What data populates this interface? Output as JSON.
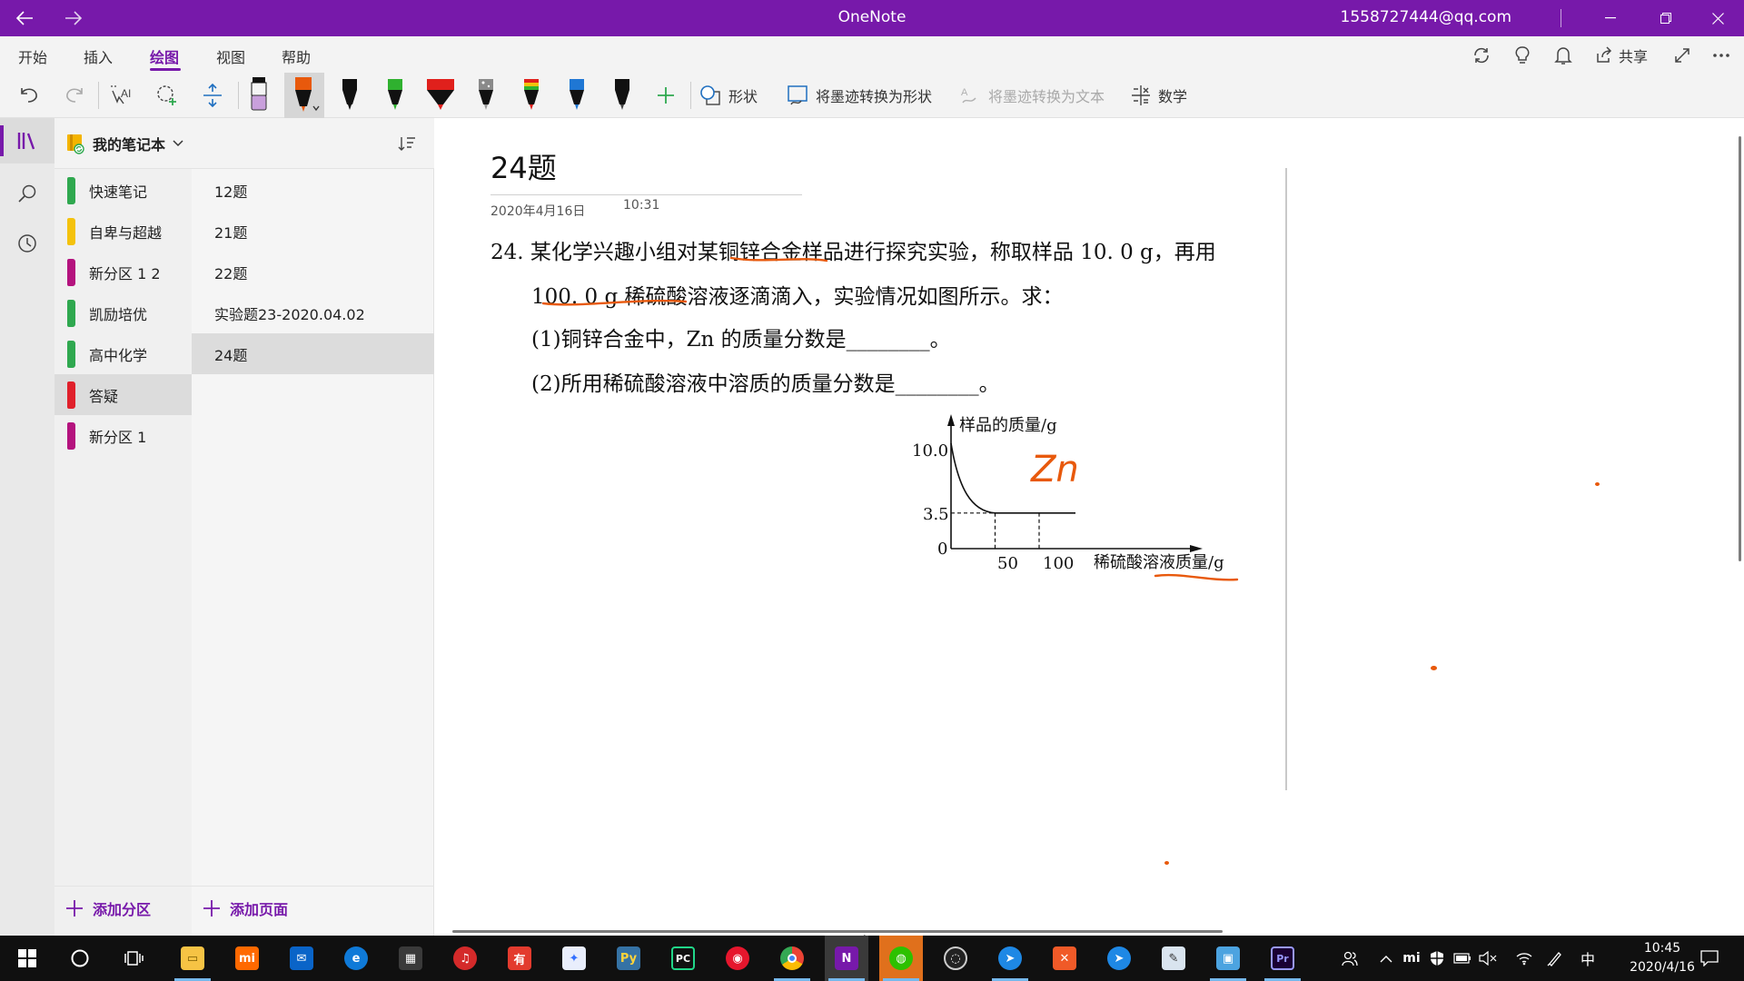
{
  "window": {
    "title": "OneNote",
    "account": "1558727444@qq.com"
  },
  "menu": {
    "items": [
      "开始",
      "插入",
      "绘图",
      "视图",
      "帮助"
    ],
    "active": "绘图",
    "share_label": "共享"
  },
  "toolbar": {
    "shape_label": "形状",
    "ink_to_shape_label": "将墨迹转换为形状",
    "ink_to_text_label": "将墨迹转换为文本",
    "math_label": "数学",
    "pens": [
      {
        "color": "#c9a0dc",
        "kind": "highlighter"
      },
      {
        "color": "#e8590c",
        "kind": "pen",
        "selected": true
      },
      {
        "color": "#111111",
        "kind": "pen"
      },
      {
        "color": "#2fb12f",
        "kind": "pen"
      },
      {
        "color": "#e0201c",
        "kind": "marker"
      },
      {
        "color": "#8a8a8a",
        "kind": "galaxy"
      },
      {
        "color": "#d4a017",
        "kind": "rainbow"
      },
      {
        "color": "#1f77d4",
        "kind": "pen"
      },
      {
        "color": "#111111",
        "kind": "pencil"
      }
    ]
  },
  "notebook": {
    "name": "我的笔记本",
    "sections": [
      {
        "label": "快速笔记",
        "color": "#2fa84f"
      },
      {
        "label": "自卑与超越",
        "color": "#f4c20d"
      },
      {
        "label": "新分区 1 2",
        "color": "#b4137e"
      },
      {
        "label": "凯励培优",
        "color": "#2fa84f"
      },
      {
        "label": "高中化学",
        "color": "#2fa84f"
      },
      {
        "label": "答疑",
        "color": "#e0202b",
        "selected": true
      },
      {
        "label": "新分区 1",
        "color": "#b4137e"
      }
    ],
    "pages": [
      {
        "label": "12题"
      },
      {
        "label": "21题"
      },
      {
        "label": "22题"
      },
      {
        "label": "实验题23-2020.04.02"
      },
      {
        "label": "24题",
        "selected": true
      }
    ],
    "add_section": "添加分区",
    "add_page": "添加页面"
  },
  "page": {
    "title": "24题",
    "date": "2020年4月16日",
    "time": "10:31",
    "question": {
      "line1": "24. 某化学兴趣小组对某铜锌合金样品进行探究实验，称取样品 10. 0 g，再用",
      "line2": "100. 0 g 稀硫酸溶液逐滴滴入，实验情况如图所示。求：",
      "line3": "(1)铜锌合金中，Zn 的质量分数是________。",
      "line4": "(2)所用稀硫酸溶液中溶质的质量分数是________。"
    },
    "figure": {
      "ylabel": "样品的质量/g",
      "xlabel": "稀硫酸溶液质量/g",
      "y_ticks": [
        "10.0",
        "3.5",
        "0"
      ],
      "x_ticks": [
        "50",
        "100"
      ],
      "handwriting": "Zn"
    }
  },
  "chart_data": {
    "type": "line",
    "x": [
      0,
      50,
      100
    ],
    "y": [
      10.0,
      3.5,
      3.5
    ],
    "xlabel": "稀硫酸溶液质量/g",
    "ylabel": "样品的质量/g"
  },
  "colors": {
    "accent": "#7719aa",
    "ink": "#e8590c"
  },
  "taskbar": {
    "apps": [
      "windows-start",
      "search",
      "task-view",
      "file-explorer",
      "mi",
      "mail",
      "edge",
      "store",
      "netease-music",
      "youdao",
      "feishu",
      "python",
      "pycharm",
      "weibo",
      "chrome",
      "onenote",
      "wechat",
      "obs",
      "dingtalk",
      "xmind",
      "dingtalk-2",
      "notepad",
      "control-panel",
      "premiere"
    ],
    "ime": "中",
    "time": "10:45",
    "date": "2020/4/16"
  }
}
